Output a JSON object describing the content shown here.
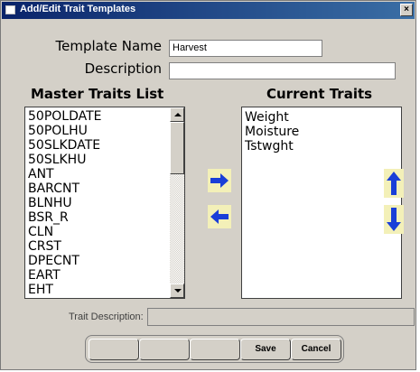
{
  "window": {
    "title": "Add/Edit Trait Templates",
    "close_label": "×"
  },
  "form": {
    "template_name_label": "Template Name",
    "template_name_value": "Harvest",
    "description_label": "Description",
    "description_value": ""
  },
  "master": {
    "header": "Master Traits List",
    "items": [
      "50POLDATE",
      "50POLHU",
      "50SLKDATE",
      "50SLKHU",
      "ANT",
      "BARCNT",
      "BLNHU",
      "BSR_R",
      "CLN",
      "CRST",
      "DPECNT",
      "EART",
      "EHT"
    ]
  },
  "current": {
    "header": "Current Traits",
    "items": [
      "Weight",
      "Moisture",
      "Tstwght"
    ]
  },
  "trait_description": {
    "label": "Trait Description:",
    "value": ""
  },
  "buttons": {
    "b1": "",
    "b2": "",
    "b3": "",
    "save": "Save",
    "cancel": "Cancel"
  },
  "icons": {
    "add": "arrow-right-icon",
    "remove": "arrow-left-icon",
    "move_up": "arrow-up-icon",
    "move_down": "arrow-down-icon"
  },
  "colors": {
    "arrow": "#1a3fd8",
    "arrow_btn_bg": "#f3f0b8",
    "title_bar": "#0a246a"
  }
}
